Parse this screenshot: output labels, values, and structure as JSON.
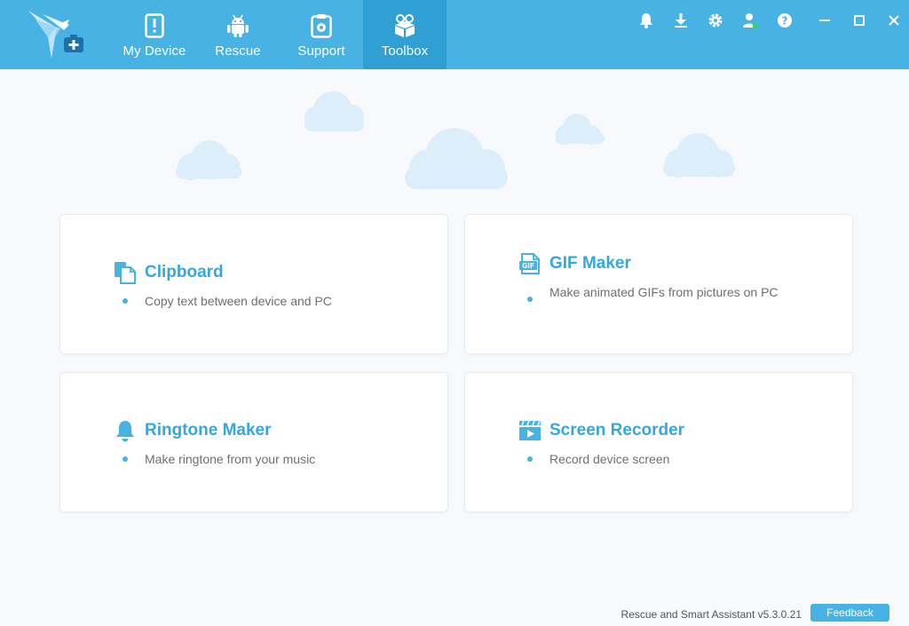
{
  "tabs": [
    {
      "label": "My Device",
      "icon": "phone-alert-icon"
    },
    {
      "label": "Rescue",
      "icon": "android-icon"
    },
    {
      "label": "Support",
      "icon": "clipboard-gear-icon"
    },
    {
      "label": "Toolbox",
      "icon": "toolbox-icon"
    }
  ],
  "active_tab": "Toolbox",
  "window_icons": [
    "bell-icon",
    "download-icon",
    "gear-icon",
    "user-icon",
    "help-icon",
    "minimize-icon",
    "maximize-icon",
    "close-icon"
  ],
  "cards": [
    {
      "title": "Clipboard",
      "desc": "Copy text between device and PC",
      "icon": "clipboard-icon"
    },
    {
      "title": "GIF Maker",
      "desc": "Make animated GIFs from pictures on PC",
      "icon": "gif-icon",
      "icon_text": "GIF"
    },
    {
      "title": "Ringtone Maker",
      "desc": "Make ringtone from your music",
      "icon": "bell-icon"
    },
    {
      "title": "Screen Recorder",
      "desc": "Record device screen",
      "icon": "video-recorder-icon"
    }
  ],
  "footer": {
    "version_text": "Rescue and Smart Assistant v5.3.0.21",
    "feedback_label": "Feedback"
  },
  "colors": {
    "accent": "#47b2e3",
    "accent_dark": "#2f9fd4",
    "title_blue": "#35a7dc",
    "background": "#f7f9fc",
    "cloud": "#dbeef9"
  }
}
